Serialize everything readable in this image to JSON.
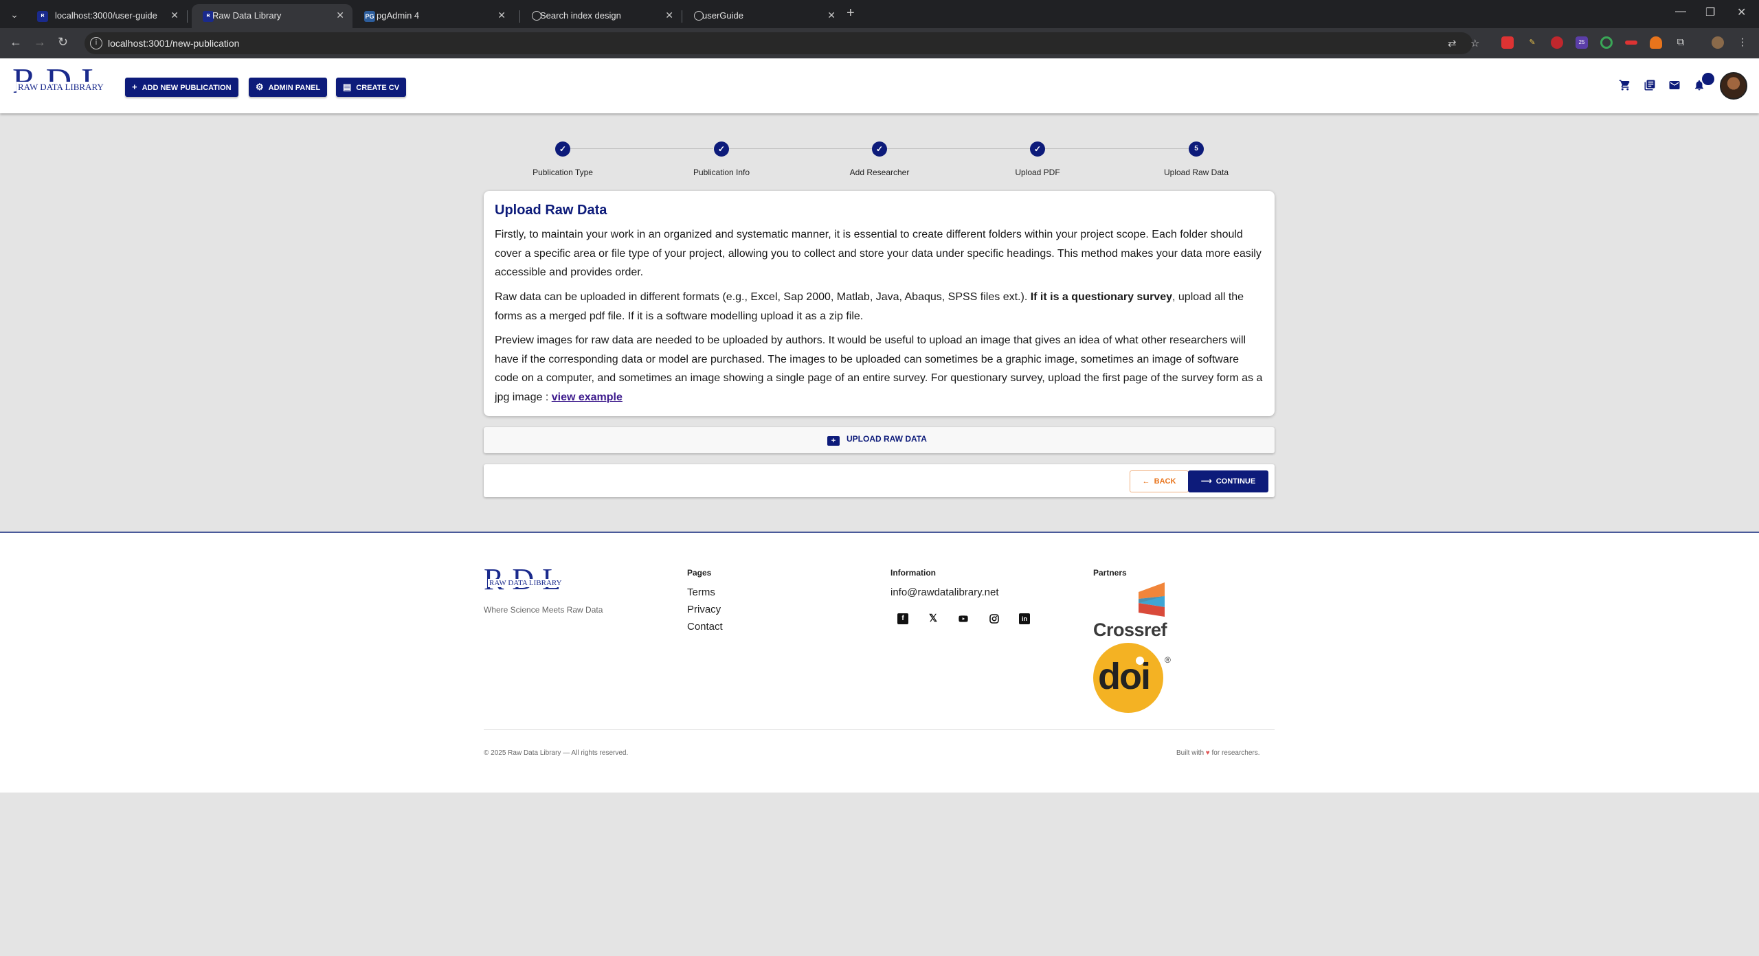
{
  "browser": {
    "tabs": [
      {
        "title": "localhost:3000/user-guide",
        "favicon": "rdl"
      },
      {
        "title": "Raw Data Library",
        "favicon": "rdl",
        "active": true
      },
      {
        "title": "pgAdmin 4",
        "favicon": "PG"
      },
      {
        "title": "Search index design",
        "favicon": "globe"
      },
      {
        "title": "userGuide",
        "favicon": "globe"
      }
    ],
    "url": "localhost:3001/new-publication"
  },
  "header": {
    "logo_letters": "RDL",
    "logo_text": "RAW DATA LIBRARY",
    "buttons": {
      "add_publication": "ADD NEW PUBLICATION",
      "admin_panel": "ADMIN PANEL",
      "create_cv": "CREATE CV"
    },
    "icons": [
      "cart-icon",
      "library-icon",
      "mail-icon",
      "bell-icon"
    ]
  },
  "stepper": {
    "steps": [
      {
        "label": "Publication Type",
        "status": "done"
      },
      {
        "label": "Publication Info",
        "status": "done"
      },
      {
        "label": "Add Researcher",
        "status": "done"
      },
      {
        "label": "Upload PDF",
        "status": "done"
      },
      {
        "label": "Upload Raw Data",
        "status": "active",
        "number": "5"
      }
    ]
  },
  "card": {
    "title": "Upload Raw Data",
    "p1": "Firstly, to maintain your work in an organized and systematic manner, it is essential to create different folders within your project scope. Each folder should cover a specific area or file type of your project, allowing you to collect and store your data under specific headings. This method makes your data more easily accessible and provides order.",
    "p2_a": "Raw data can be uploaded in different formats (e.g., Excel, Sap 2000, Matlab, Java, Abaqus, SPSS files ext.). ",
    "p2_bold": "If it is a questionary survey",
    "p2_b": ", upload all the forms as a merged pdf file. If it is a software modelling upload it as a zip file.",
    "p3": "Preview images for raw data are needed to be uploaded by authors. It would be useful to upload an image that gives an idea of what other researchers will have if the corresponding data or model are purchased. The images to be uploaded can sometimes be a graphic image, sometimes an image of software code on a computer, and sometimes an image showing a single page of an entire survey. For questionary survey, upload the first page of the survey form as a jpg image : ",
    "p3_link": "view example"
  },
  "upload_button": "UPLOAD RAW DATA",
  "actions": {
    "back": "BACK",
    "continue": "CONTINUE"
  },
  "footer": {
    "logo_letters": "RDL",
    "logo_text": "RAW DATA LIBRARY",
    "tagline": "Where Science Meets Raw Data",
    "pages_heading": "Pages",
    "pages": [
      "Terms",
      "Privacy",
      "Contact"
    ],
    "info_heading": "Information",
    "email": "info@rawdatalibrary.net",
    "partners_heading": "Partners",
    "partner_crossref": "Crossref",
    "partner_doi": "doi",
    "copyright": "© 2025 Raw Data Library — All rights reserved.",
    "built_a": "Built with",
    "built_b": "for researchers."
  },
  "colors": {
    "primary": "#0d1b7a",
    "accent_back": "#e8741c",
    "background": "#e4e4e4"
  }
}
